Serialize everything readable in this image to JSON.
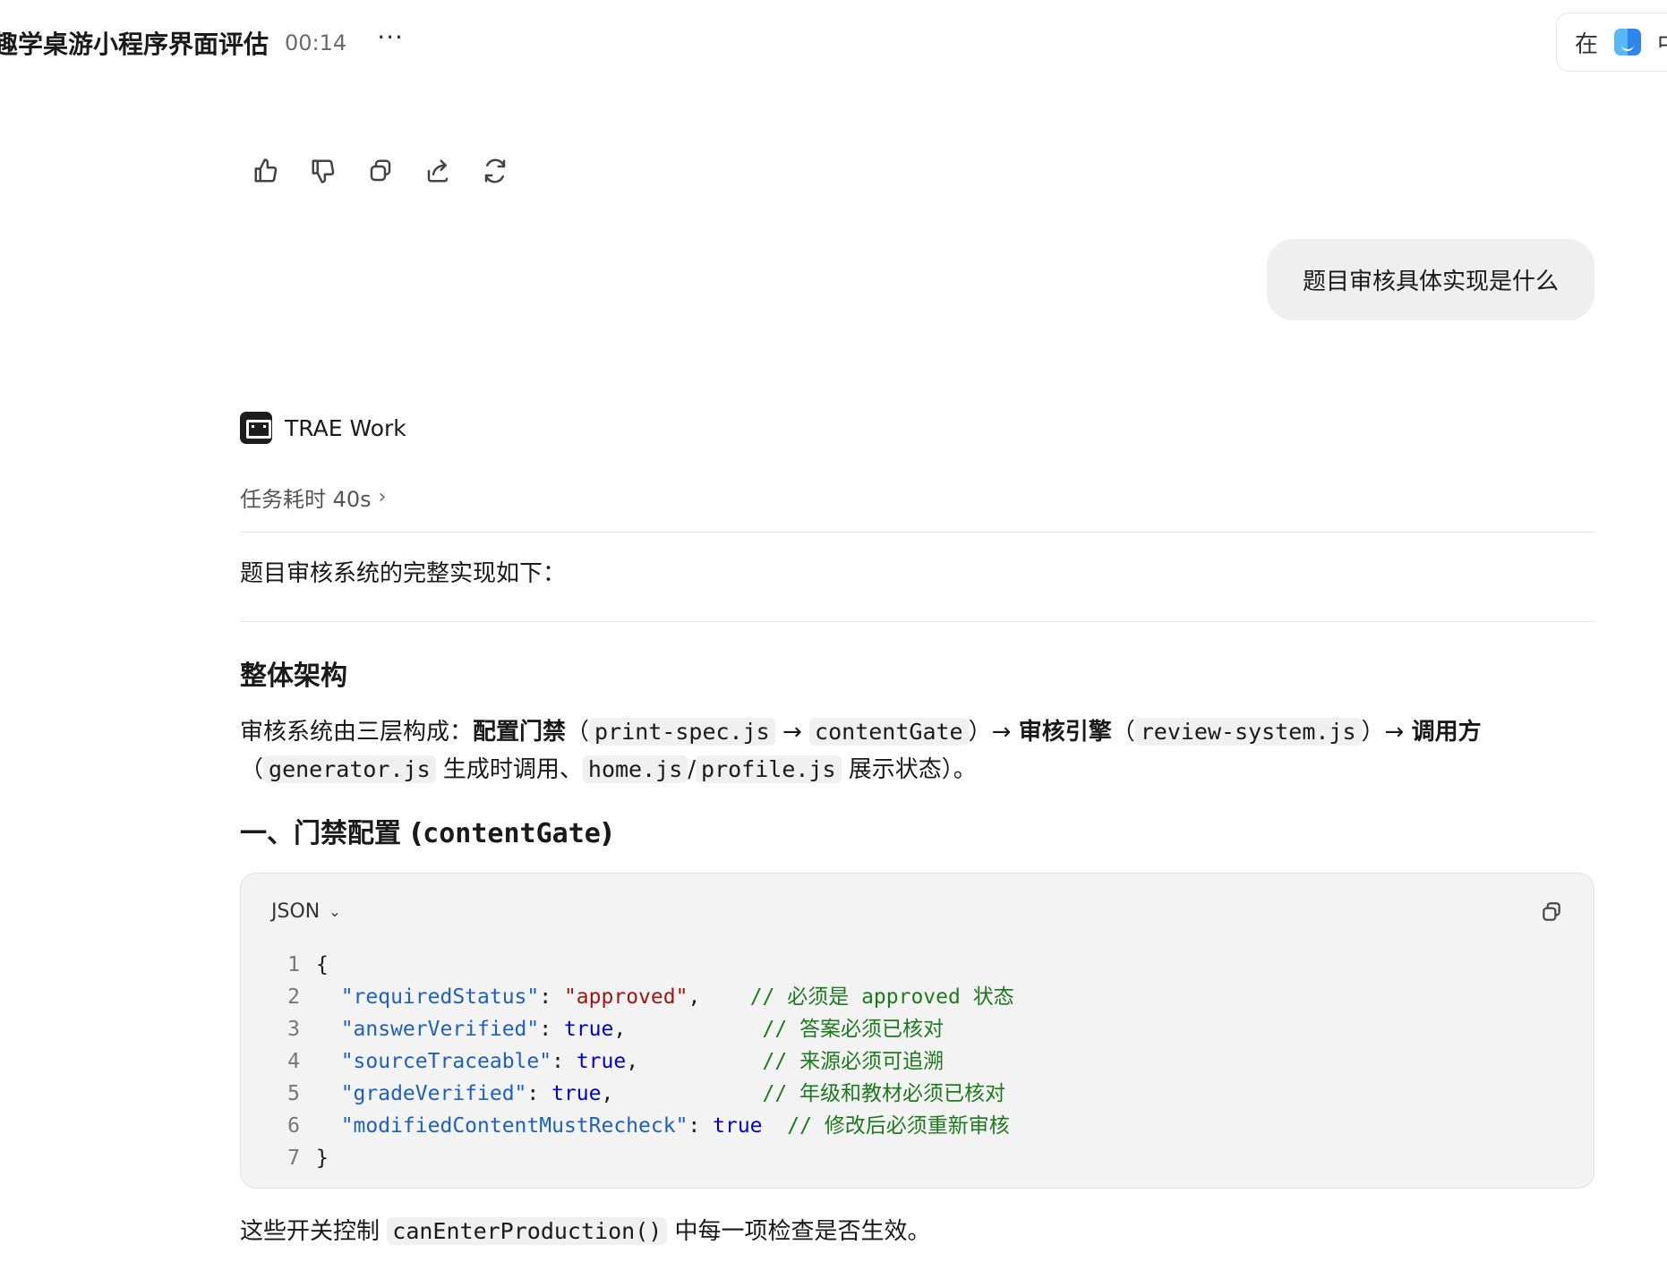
{
  "header": {
    "title": "趣学桌游小程序界面评估",
    "time": "00:14",
    "more": "···",
    "right_text": "在",
    "right_text2": "中"
  },
  "actions": [
    "like",
    "dislike",
    "copy",
    "share",
    "regenerate"
  ],
  "user_message": "题目审核具体实现是什么",
  "assistant": {
    "name": "TRAE Work",
    "duration": "任务耗时 40s",
    "intro": "题目审核系统的完整实现如下：",
    "section_title": "整体架构",
    "arch_line1": {
      "a": "审核系统由三层构成：",
      "b": "配置门禁",
      "c": "（",
      "d": "print-spec.js",
      "e": " → ",
      "f": "contentGate",
      "g": "）→ ",
      "h": "审核引擎",
      "i": "（",
      "j": "review-system.js",
      "k": "）→ ",
      "l": "调用方"
    },
    "arch_line2": {
      "a": "（",
      "b": "generator.js",
      "c": " 生成时调用、",
      "d": "home.js",
      "e": "/",
      "f": "profile.js",
      "g": " 展示状态）。"
    },
    "h2_prefix": "一、门禁配置 (",
    "h2_code": "contentGate",
    "h2_suffix": ")",
    "code": {
      "language": "JSON",
      "lines": [
        {
          "n": "1",
          "parts": [
            {
              "t": "{",
              "c": "tok-punc"
            }
          ]
        },
        {
          "n": "2",
          "parts": [
            {
              "t": "  \"requiredStatus\"",
              "c": "tok-key"
            },
            {
              "t": ": ",
              "c": "tok-punc"
            },
            {
              "t": "\"approved\"",
              "c": "tok-str"
            },
            {
              "t": ",    ",
              "c": "tok-punc"
            },
            {
              "t": "// 必须是 approved 状态",
              "c": "tok-com"
            }
          ]
        },
        {
          "n": "3",
          "parts": [
            {
              "t": "  \"answerVerified\"",
              "c": "tok-key"
            },
            {
              "t": ": ",
              "c": "tok-punc"
            },
            {
              "t": "true",
              "c": "tok-bool"
            },
            {
              "t": ",           ",
              "c": "tok-punc"
            },
            {
              "t": "// 答案必须已核对",
              "c": "tok-com"
            }
          ]
        },
        {
          "n": "4",
          "parts": [
            {
              "t": "  \"sourceTraceable\"",
              "c": "tok-key"
            },
            {
              "t": ": ",
              "c": "tok-punc"
            },
            {
              "t": "true",
              "c": "tok-bool"
            },
            {
              "t": ",          ",
              "c": "tok-punc"
            },
            {
              "t": "// 来源必须可追溯",
              "c": "tok-com"
            }
          ]
        },
        {
          "n": "5",
          "parts": [
            {
              "t": "  \"gradeVerified\"",
              "c": "tok-key"
            },
            {
              "t": ": ",
              "c": "tok-punc"
            },
            {
              "t": "true",
              "c": "tok-bool"
            },
            {
              "t": ",            ",
              "c": "tok-punc"
            },
            {
              "t": "// 年级和教材必须已核对",
              "c": "tok-com"
            }
          ]
        },
        {
          "n": "6",
          "parts": [
            {
              "t": "  \"modifiedContentMustRecheck\"",
              "c": "tok-key"
            },
            {
              "t": ": ",
              "c": "tok-punc"
            },
            {
              "t": "true",
              "c": "tok-bool"
            },
            {
              "t": "  ",
              "c": "tok-punc"
            },
            {
              "t": "// 修改后必须重新审核",
              "c": "tok-com"
            }
          ]
        },
        {
          "n": "7",
          "parts": [
            {
              "t": "}",
              "c": "tok-punc"
            }
          ]
        }
      ]
    },
    "footer": {
      "a": "这些开关控制 ",
      "b": "canEnterProduction()",
      "c": " 中每一项检查是否生效。"
    }
  }
}
